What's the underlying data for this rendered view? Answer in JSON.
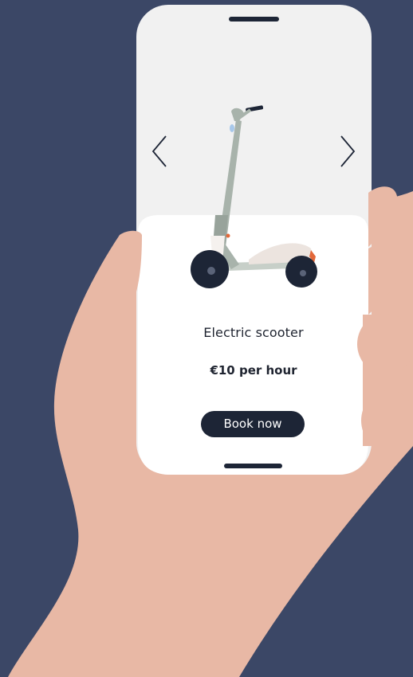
{
  "colors": {
    "background": "#3b4766",
    "skin": "#e8b8a5",
    "screen_top": "#f1f1f1",
    "card": "#ffffff",
    "button": "#1d2536",
    "text": "#1f2430"
  },
  "carousel": {
    "prev_icon": "chevron-left-icon",
    "next_icon": "chevron-right-icon"
  },
  "product": {
    "image_icon": "electric-scooter-illustration",
    "name": "Electric scooter",
    "price": "€10 per hour",
    "cta_label": "Book now"
  }
}
